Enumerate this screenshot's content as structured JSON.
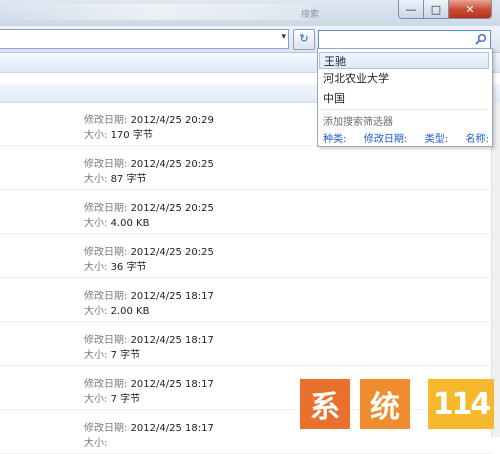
{
  "window": {
    "title_fragment": "搜索",
    "controls": {
      "minimize": "—",
      "maximize": "□",
      "close": "✕"
    }
  },
  "toolbar": {
    "address_dropdown": "▾",
    "refresh_icon": "↻"
  },
  "search": {
    "value": "",
    "icon": "search-icon",
    "suggestions": [
      "王驰",
      "河北农业大学",
      "中国"
    ],
    "selected_index": 0,
    "filter_heading": "添加搜索筛选器",
    "filters": [
      "种类:",
      "修改日期:",
      "类型:",
      "名称:"
    ]
  },
  "files": [
    {
      "date_label": "修改日期:",
      "date": "2012/4/25 20:29",
      "size_label": "大小:",
      "size": "170 字节"
    },
    {
      "date_label": "修改日期:",
      "date": "2012/4/25 20:25",
      "size_label": "大小:",
      "size": "87 字节"
    },
    {
      "date_label": "修改日期:",
      "date": "2012/4/25 20:25",
      "size_label": "大小:",
      "size": "4.00 KB"
    },
    {
      "date_label": "修改日期:",
      "date": "2012/4/25 20:25",
      "size_label": "大小:",
      "size": "36 字节"
    },
    {
      "date_label": "修改日期:",
      "date": "2012/4/25 18:17",
      "size_label": "大小:",
      "size": "2.00 KB"
    },
    {
      "date_label": "修改日期:",
      "date": "2012/4/25 18:17",
      "size_label": "大小:",
      "size": "7 字节"
    },
    {
      "date_label": "修改日期:",
      "date": "2012/4/25 18:17",
      "size_label": "大小:",
      "size": "7 字节"
    },
    {
      "date_label": "修改日期:",
      "date": "2012/4/25 18:17",
      "size_label": "大小:",
      "size": ""
    }
  ],
  "watermark": {
    "chars": [
      "系",
      "统",
      "114"
    ]
  },
  "colors": {
    "accent_link": "#1a5fc4",
    "selection": "#dceafb",
    "logo_1": "#e9702d",
    "logo_2": "#ef8d2e",
    "logo_3": "#f5b82e"
  }
}
